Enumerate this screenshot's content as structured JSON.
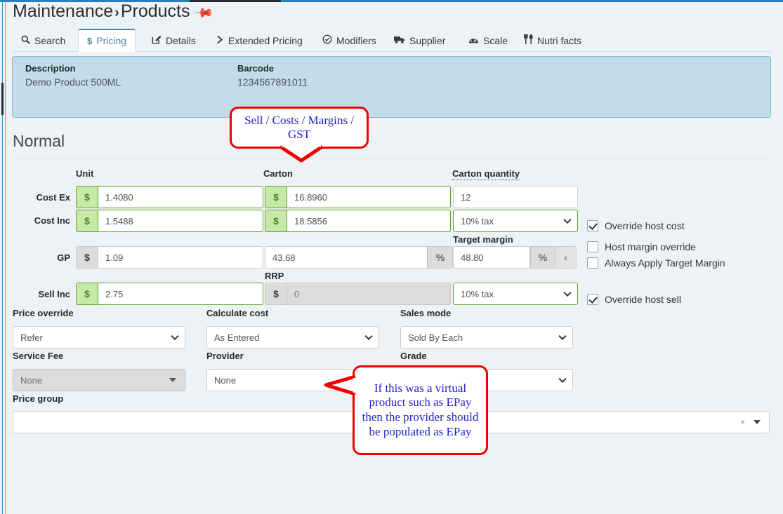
{
  "header": {
    "breadcrumb_root": "Maintenance",
    "breadcrumb_sep": "›",
    "breadcrumb_current": "Products",
    "pin_icon": "pin-icon"
  },
  "tabs": [
    {
      "label": "Search",
      "icon": "search-icon",
      "glyph": "⌕",
      "active": false
    },
    {
      "label": "Pricing",
      "icon": "dollar-icon",
      "glyph": "$",
      "active": true
    },
    {
      "label": "Details",
      "icon": "edit-icon",
      "glyph": "✎",
      "active": false
    },
    {
      "label": "Extended Pricing",
      "icon": "chevron-right-icon",
      "glyph": "›",
      "active": false
    },
    {
      "label": "Modifiers",
      "icon": "check-circle-icon",
      "glyph": "⊘",
      "active": false
    },
    {
      "label": "Supplier",
      "icon": "truck-icon",
      "glyph": "▤",
      "active": false
    },
    {
      "label": "Scale",
      "icon": "gauge-icon",
      "glyph": "◔",
      "active": false
    },
    {
      "label": "Nutri facts",
      "icon": "utensils-icon",
      "glyph": "Ψ",
      "active": false
    }
  ],
  "info_panel": {
    "description_label": "Description",
    "description_value": "Demo Product 500ML",
    "barcode_label": "Barcode",
    "barcode_value": "1234567891011"
  },
  "section": {
    "title": "Normal"
  },
  "grid": {
    "col_unit": "Unit",
    "col_carton": "Carton",
    "col_carton_qty": "Carton quantity",
    "label_target_margin": "Target margin",
    "label_rrp": "RRP",
    "rows": {
      "cost_ex": {
        "label": "Cost Ex",
        "unit_prefix": "$",
        "unit_value": "1.4080",
        "carton_prefix": "$",
        "carton_value": "16.8960",
        "carton_qty": "12"
      },
      "cost_inc": {
        "label": "Cost Inc",
        "unit_prefix": "$",
        "unit_value": "1.5488",
        "carton_prefix": "$",
        "carton_value": "18.5856",
        "tax": "10% tax"
      },
      "gp": {
        "label": "GP",
        "prefix": "$",
        "value": "1.09",
        "percent_value": "43.68",
        "percent_suffix": "%",
        "target_margin_value": "48.80",
        "target_margin_suffix": "%",
        "apply_button": "‹"
      },
      "sell_inc": {
        "label": "Sell Inc",
        "prefix": "$",
        "value": "2.75",
        "rrp_prefix": "$",
        "rrp_value": "0",
        "tax": "10% tax"
      }
    }
  },
  "checkboxes": [
    {
      "label": "Override host cost",
      "checked": true
    },
    {
      "label": "Host margin override",
      "checked": false
    },
    {
      "label": "Always Apply Target Margin",
      "checked": false
    },
    {
      "label": "Override host sell",
      "checked": true
    }
  ],
  "fields": {
    "price_override": {
      "label": "Price override",
      "value": "Refer"
    },
    "calculate_cost": {
      "label": "Calculate cost",
      "value": "As Entered"
    },
    "sales_mode": {
      "label": "Sales mode",
      "value": "Sold By Each"
    },
    "service_fee": {
      "label": "Service Fee",
      "value": "None"
    },
    "provider": {
      "label": "Provider",
      "value": "None"
    },
    "grade": {
      "label": "Grade",
      "value": ""
    },
    "price_group": {
      "label": "Price group",
      "value": "",
      "clear_icon": "×"
    }
  },
  "annotations": [
    {
      "name": "sell-costs-margins-gst-callout",
      "text": "Sell /  Costs / Margins / GST"
    },
    {
      "name": "provider-epay-callout",
      "text": "If this was a virtual product such as EPay then the provider should be populated as EPay"
    }
  ],
  "colors": {
    "accent_blue": "#2980b9",
    "panel_blue": "#c3dcea",
    "valid_green": "#5aa52b",
    "annotation_red": "#f20000",
    "annotation_text": "#2222cc",
    "background": "#eef2f5"
  }
}
